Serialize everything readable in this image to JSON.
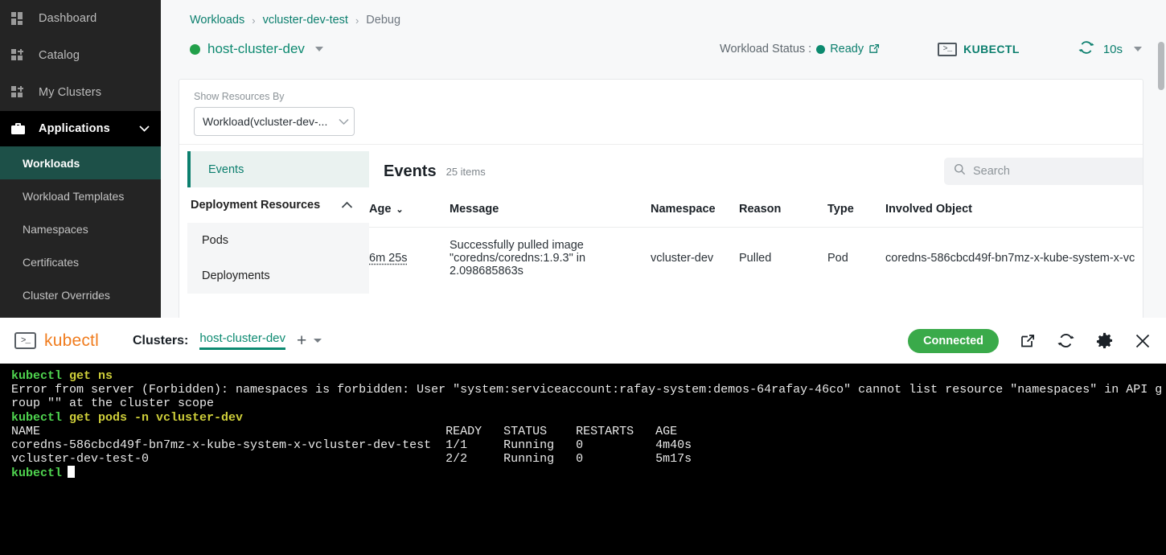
{
  "sidebar": {
    "items": [
      {
        "label": "Dashboard",
        "icon": "grid-icon"
      },
      {
        "label": "Catalog",
        "icon": "catalog-icon"
      },
      {
        "label": "My Clusters",
        "icon": "clusters-icon"
      }
    ],
    "group": {
      "label": "Applications",
      "icon": "briefcase-icon",
      "chevron": "⌄"
    },
    "sub_items": [
      {
        "label": "Workloads",
        "active": true
      },
      {
        "label": "Workload Templates",
        "active": false
      },
      {
        "label": "Namespaces",
        "active": false
      },
      {
        "label": "Certificates",
        "active": false
      },
      {
        "label": "Cluster Overrides",
        "active": false
      }
    ]
  },
  "breadcrumb": {
    "items": [
      "Workloads",
      "vcluster-dev-test",
      "Debug"
    ],
    "separator": "›"
  },
  "header": {
    "cluster_name": "host-cluster-dev",
    "cluster_status_color": "#22a04a",
    "workload_status_label": "Workload Status :",
    "workload_status_value": "Ready",
    "kubectl_label": "KUBECTL",
    "refresh_interval": "10s"
  },
  "resources_panel": {
    "select_label": "Show Resources By",
    "select_value": "Workload(vcluster-dev-...",
    "nav": {
      "events": "Events",
      "section": "Deployment Resources",
      "sub": [
        "Pods",
        "Deployments"
      ]
    }
  },
  "events": {
    "title": "Events",
    "count_label": "25 items",
    "search_placeholder": "Search",
    "search_value": "",
    "columns": [
      "Age",
      "Message",
      "Namespace",
      "Reason",
      "Type",
      "Involved Object"
    ],
    "sorted_column": "Age",
    "sort_caret": "⌄",
    "rows": [
      {
        "age": "6m 25s",
        "message": "Successfully pulled image \"coredns/coredns:1.9.3\" in 2.098685863s",
        "namespace": "vcluster-dev",
        "reason": "Pulled",
        "type": "Pod",
        "involved_object": "coredns-586cbcd49f-bn7mz-x-kube-system-x-vc"
      }
    ]
  },
  "drawer": {
    "brand": "kubectl",
    "brand_color": "#f07c1e",
    "prompt_glyph": ">_",
    "clusters_label": "Clusters:",
    "cluster_tab": "host-cluster-dev",
    "add_tab": "+",
    "connected_label": "Connected",
    "connected_color": "#3aaa4a",
    "icons": [
      "external-link-icon",
      "refresh-icon",
      "gear-icon",
      "close-icon"
    ]
  },
  "terminal": {
    "lines": [
      {
        "type": "command",
        "cmd": "kubectl",
        "args": " get ns"
      },
      {
        "type": "output",
        "text": "Error from server (Forbidden): namespaces is forbidden: User \"system:serviceaccount:rafay-system:demos-64rafay-46co\" cannot list resource \"namespaces\" in API g"
      },
      {
        "type": "output",
        "text": "roup \"\" at the cluster scope"
      },
      {
        "type": "command",
        "cmd": "kubectl",
        "args": " get pods -n vcluster-dev"
      },
      {
        "type": "output",
        "text": "NAME                                                        READY   STATUS    RESTARTS   AGE"
      },
      {
        "type": "output",
        "text": "coredns-586cbcd49f-bn7mz-x-kube-system-x-vcluster-dev-test  1/1     Running   0          4m40s"
      },
      {
        "type": "output",
        "text": "vcluster-dev-test-0                                         2/2     Running   0          5m17s"
      },
      {
        "type": "prompt",
        "cmd": "kubectl",
        "args": ""
      }
    ]
  }
}
